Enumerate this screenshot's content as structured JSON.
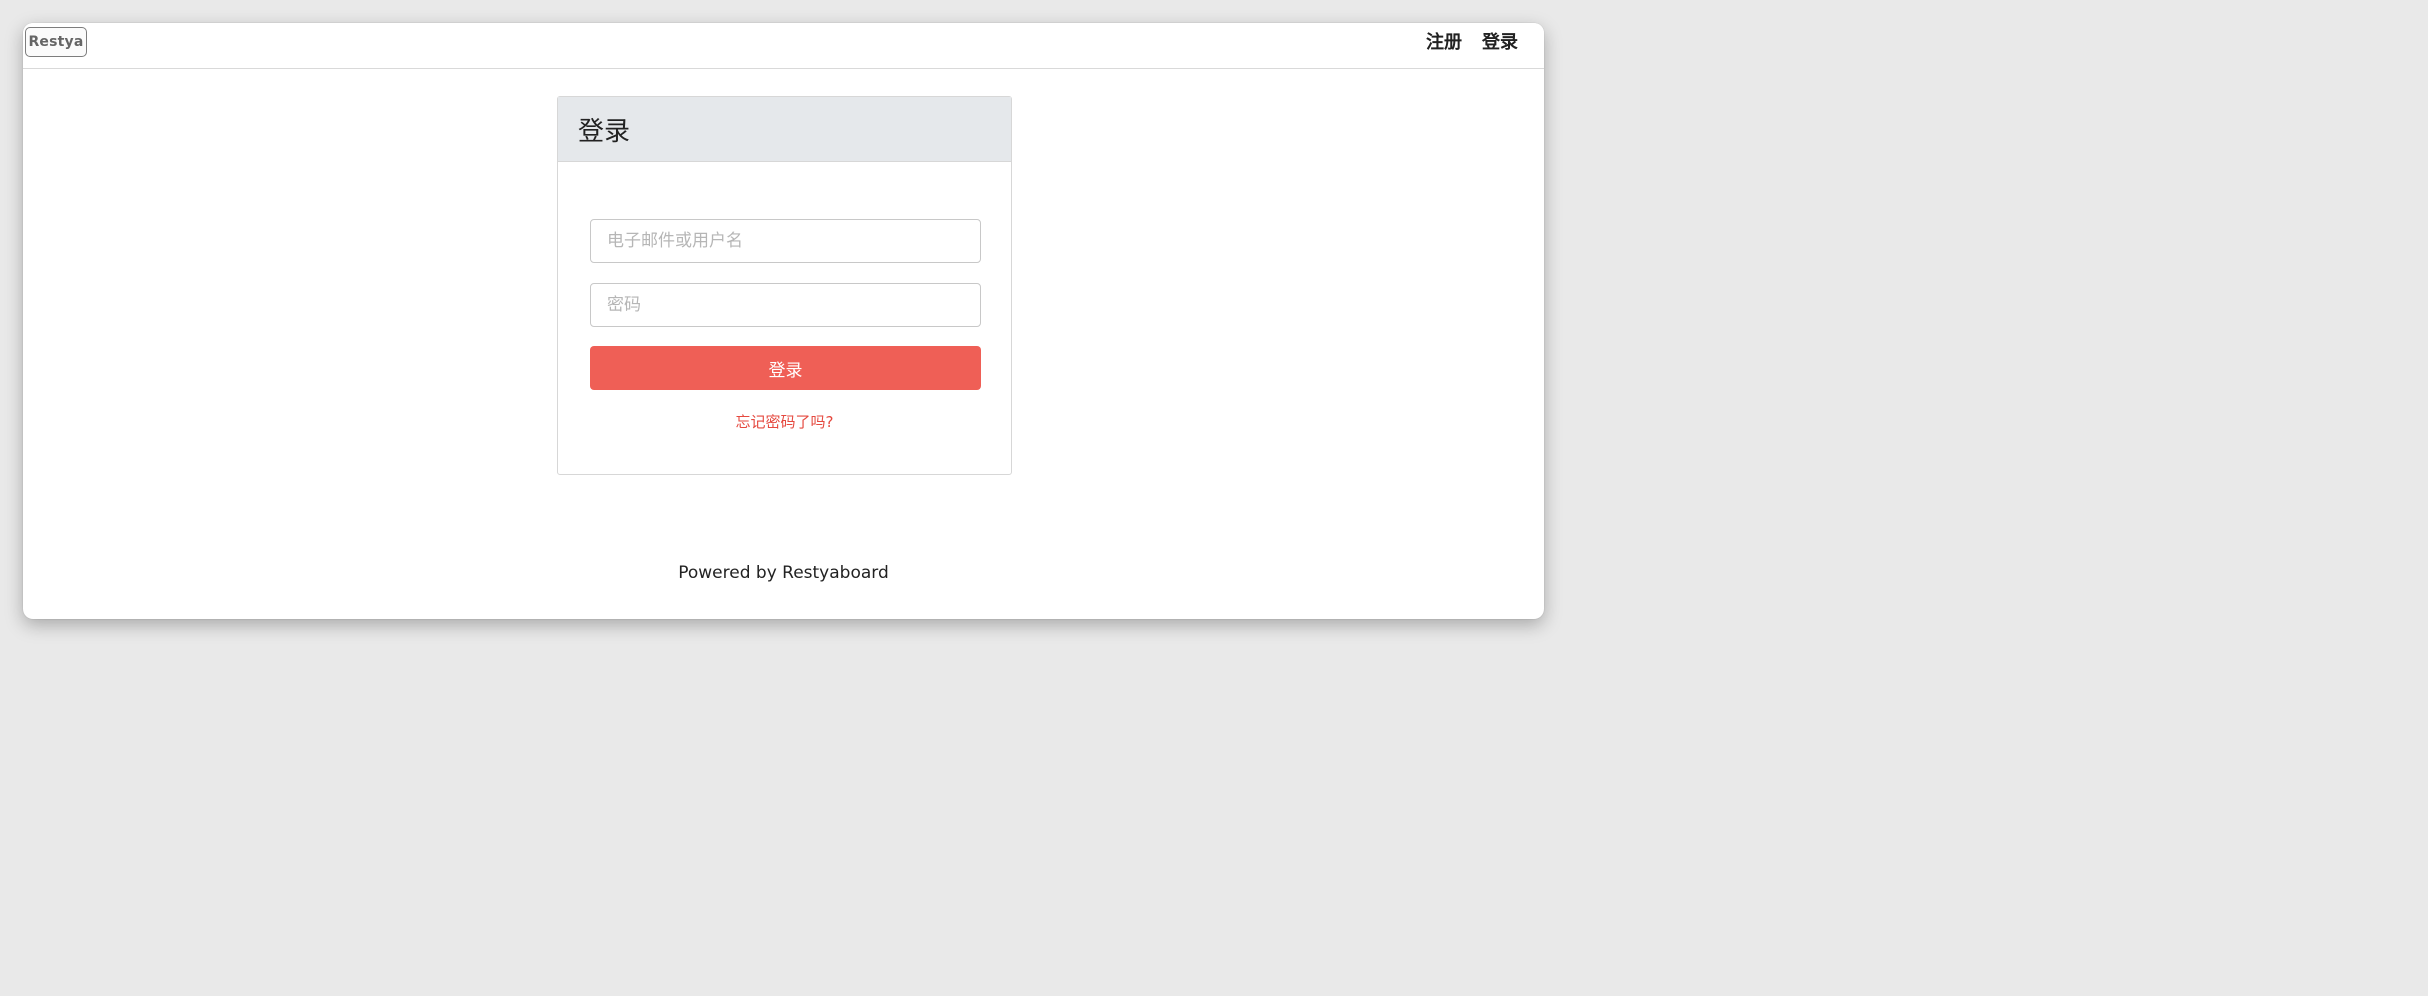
{
  "brand": {
    "logo_text": "Restya"
  },
  "nav": {
    "register": "注册",
    "login": "登录"
  },
  "login_card": {
    "title": "登录",
    "email_placeholder": "电子邮件或用户名",
    "password_placeholder": "密码",
    "submit_label": "登录",
    "forgot_link": "忘记密码了吗?"
  },
  "footer": {
    "text": "Powered by Restyaboard"
  },
  "colors": {
    "primary_button": "#ef5f56",
    "link": "#e5493f",
    "card_header": "#e5e8eb"
  }
}
